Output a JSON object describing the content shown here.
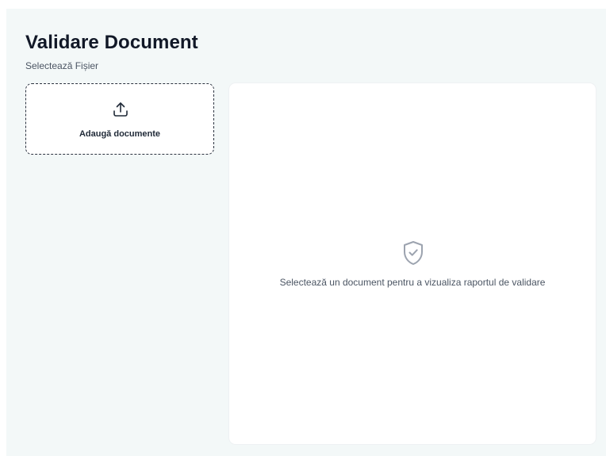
{
  "header": {
    "title": "Validare Document",
    "subtitle": "Selectează Fișier"
  },
  "upload": {
    "label": "Adaugă documente",
    "icon": "upload-icon"
  },
  "report": {
    "empty_message": "Selectează un document pentru a vizualiza raportul de validare",
    "icon": "shield-check-icon"
  },
  "colors": {
    "background": "#f3f8f8",
    "panel": "#ffffff",
    "title": "#111827",
    "muted_text": "#4b5563",
    "icon_muted": "#9ca3af",
    "border_dashed": "#2b3340"
  }
}
